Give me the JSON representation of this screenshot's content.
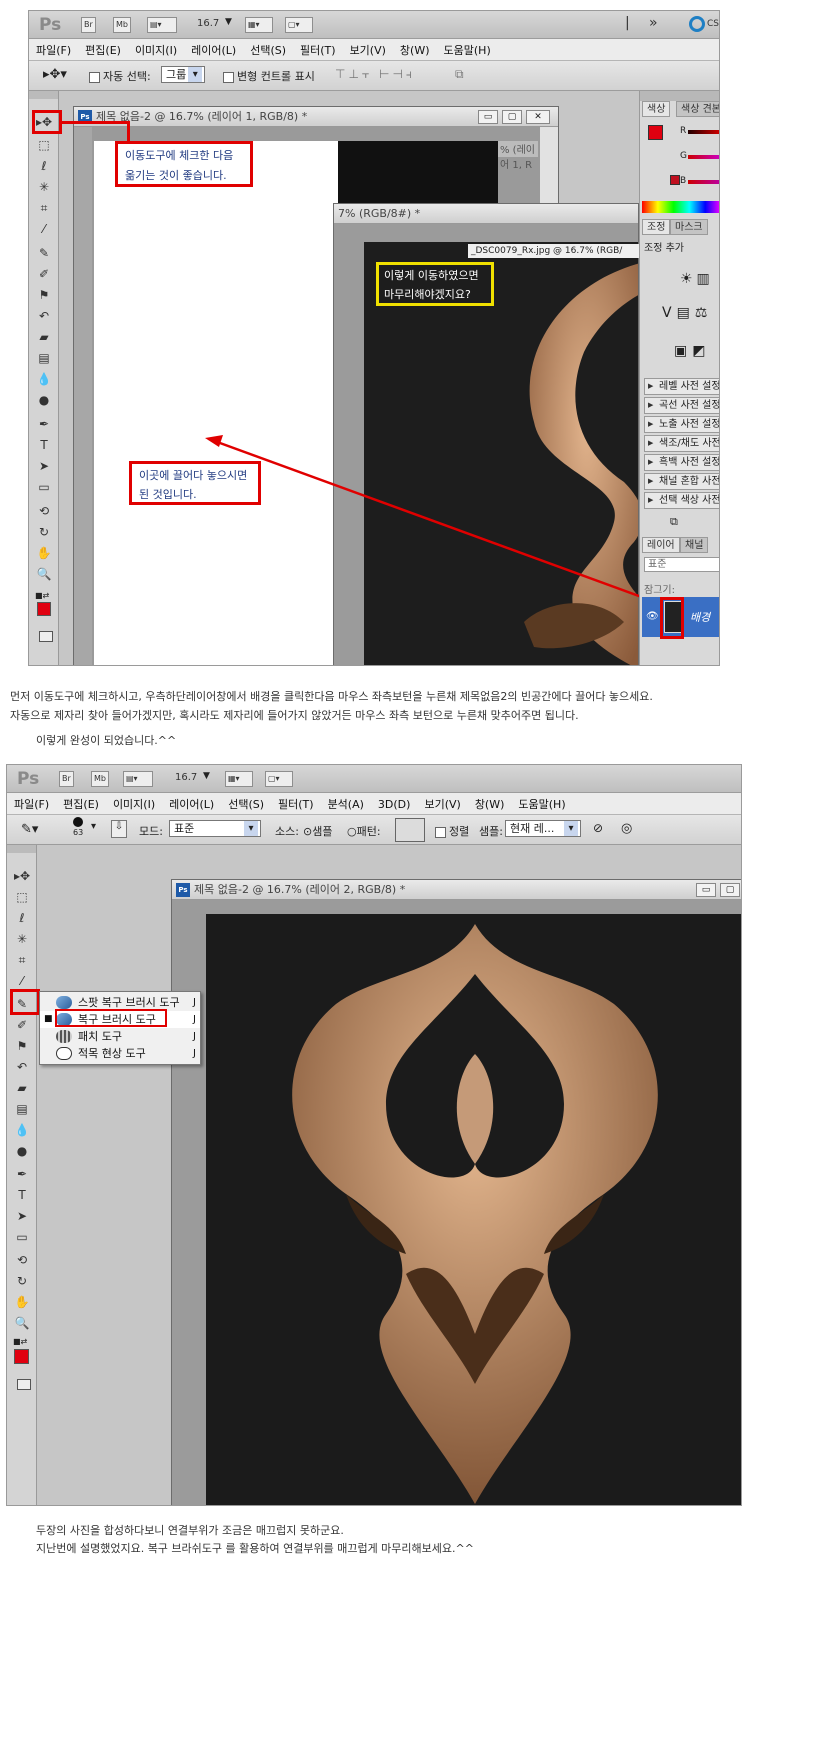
{
  "shot1": {
    "app": {
      "logo": "Ps",
      "br": "Br",
      "mb": "Mb",
      "zoom": "16.7",
      "cs_label": "CS"
    },
    "menu": [
      "파일(F)",
      "편집(E)",
      "이미지(I)",
      "레이어(L)",
      "선택(S)",
      "필터(T)",
      "보기(V)",
      "창(W)",
      "도움말(H)"
    ],
    "options": {
      "auto_select_label": "자동 선택:",
      "auto_select_value": "그룹",
      "transform_label": "변형 컨트롤 표시"
    },
    "doc1_title": "제목 없음-2 @ 16.7% (레이어 1, RGB/8) *",
    "doc2_title": "7% (RGB/8#) *",
    "doc1_behind_title": "% (레이어 1, R",
    "doc3_label": "_DSC0079_Rx.jpg @ 16.7% (RGB/",
    "color_panel": {
      "tab1": "색상",
      "tab2": "색상 견본",
      "r": "R",
      "g": "G",
      "b": "B"
    },
    "adj_panel": {
      "tab1": "조정",
      "tab2": "마스크",
      "add_label": "조정 추가",
      "items": [
        "레벨 사전 설정",
        "곡선 사전 설정",
        "노출 사전 설정",
        "색조/채도 사전 설정",
        "흑백 사전 설정",
        "채널 혼합 사전 설정",
        "선택 색상 사전 설정"
      ]
    },
    "layers_panel": {
      "tab1": "레이어",
      "tab2": "채널",
      "mode": "표준",
      "lock_label": "잠그기:",
      "layer_name": "배경"
    },
    "callout_top": "이동도구에 체크한 다음\n옮기는 것이 좋습니다.",
    "callout_mid": "이렇게 이동하였으면\n마무리해야겠지요?",
    "callout_bottom": "이곳에 끌어다 놓으시면\n된 것입니다."
  },
  "text1": "먼저 이동도구에 체크하시고, 우측하단레이어창에서 배경을 클릭한다음 마우스 좌측보턴을 누른채 제목없음2의 빈공간에다 끌어다 놓으세요.",
  "text2": "자동으로 제자리 찾아 들어가겠지만, 혹시라도 제자리에 들어가지 않았거든 마우스 좌측 보턴으로 누른채 맞추어주면 됩니다.",
  "text3": "이렇게 완성이 되었습니다.^^",
  "shot2": {
    "app": {
      "logo": "Ps",
      "br": "Br",
      "mb": "Mb",
      "zoom": "16.7"
    },
    "menu": [
      "파일(F)",
      "편집(E)",
      "이미지(I)",
      "레이어(L)",
      "선택(S)",
      "필터(T)",
      "분석(A)",
      "3D(D)",
      "보기(V)",
      "창(W)",
      "도움말(H)"
    ],
    "options": {
      "brush_size": "63",
      "mode_label": "모드:",
      "mode_value": "표준",
      "source_label": "소스:",
      "sample_label": "샘플",
      "pattern_label": "패턴:",
      "align_label": "정렬",
      "sample2_label": "샘플:",
      "sample2_value": "현재 레..."
    },
    "doc_title": "제목 없음-2 @ 16.7% (레이어 2, RGB/8) *",
    "flyout": [
      {
        "label": "스팟 복구 브러시 도구",
        "key": "J"
      },
      {
        "label": "복구 브러시 도구",
        "key": "J"
      },
      {
        "label": "패치 도구",
        "key": "J"
      },
      {
        "label": "적목 현상 도구",
        "key": "J"
      }
    ]
  },
  "text4": "두장의 사진을 합성하다보니 연결부위가 조금은 매끄럽지 못하군요.",
  "text5": "지난번에 설명했었지요. 복구 브라쉬도구 를 활용하여 연결부위를 매끄럽게 마무리해보세요.^^",
  "colors": {
    "accent_red": "#e00000",
    "callout_yellow": "#f0e000",
    "callout_text": "#203a80",
    "layer_blue": "#3a6fc4"
  }
}
